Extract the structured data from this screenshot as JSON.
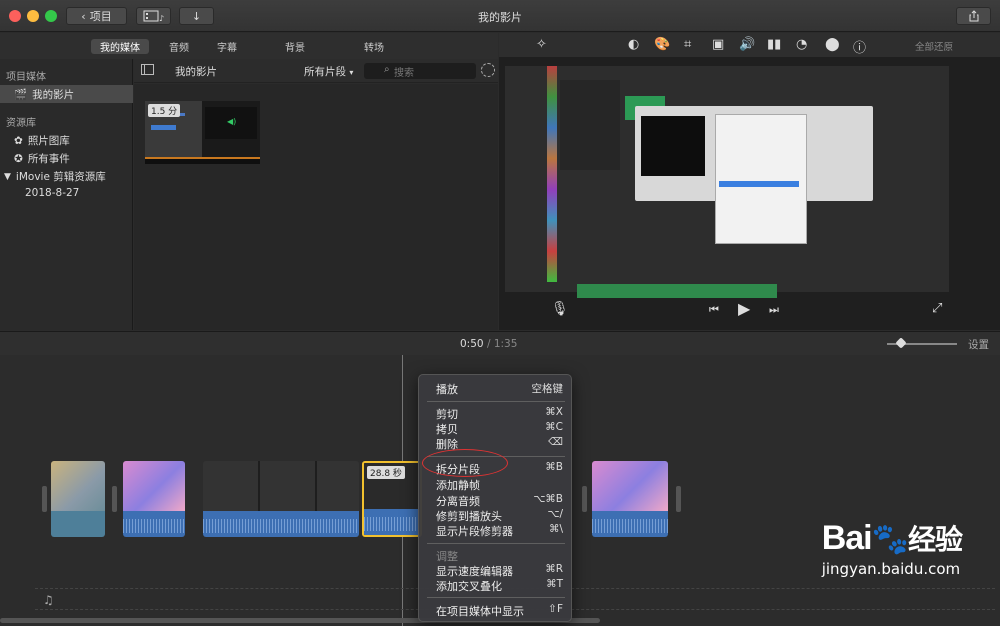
{
  "window": {
    "title": "我的影片",
    "back_label": "项目"
  },
  "browser": {
    "tabs": [
      "我的媒体",
      "音频",
      "字幕",
      "背景",
      "转场"
    ],
    "active_tab": 0,
    "sidebar": {
      "section1": "项目媒体",
      "item_my_movie": "我的影片",
      "section2": "资源库",
      "photo_library": "照片图库",
      "all_events": "所有事件",
      "imovie_library": "iMovie 剪辑资源库",
      "event_date": "2018-8-27"
    },
    "toolbar": {
      "title": "我的影片",
      "filter": "所有片段",
      "search_placeholder": "搜索"
    },
    "thumb_duration": "1.5 分"
  },
  "viewer": {
    "reset_label": "全部还原"
  },
  "timeline": {
    "time_current": "0:50",
    "time_sep": "/",
    "time_total": "1:35",
    "settings_label": "设置",
    "selected_clip_duration": "28.8 秒"
  },
  "context_menu": {
    "items": [
      {
        "label": "播放",
        "shortcut": "空格键",
        "disabled": false
      },
      {
        "label": "剪切",
        "shortcut": "⌘X",
        "disabled": false
      },
      {
        "label": "拷贝",
        "shortcut": "⌘C",
        "disabled": false
      },
      {
        "label": "删除",
        "shortcut": "⌫",
        "disabled": false
      },
      {
        "label": "拆分片段",
        "shortcut": "⌘B",
        "disabled": false
      },
      {
        "label": "添加静帧",
        "shortcut": "",
        "disabled": false
      },
      {
        "label": "分离音频",
        "shortcut": "⌥⌘B",
        "disabled": false
      },
      {
        "label": "修剪到播放头",
        "shortcut": "⌥/",
        "disabled": false
      },
      {
        "label": "显示片段修剪器",
        "shortcut": "⌘\\",
        "disabled": false
      },
      {
        "label": "调整",
        "shortcut": "",
        "disabled": true
      },
      {
        "label": "显示速度编辑器",
        "shortcut": "⌘R",
        "disabled": false
      },
      {
        "label": "添加交叉叠化",
        "shortcut": "⌘T",
        "disabled": false
      },
      {
        "label": "在项目媒体中显示",
        "shortcut": "⇧F",
        "disabled": false
      }
    ]
  },
  "watermark": {
    "brand": "Bai",
    "brand2": "经验",
    "url": "jingyan.baidu.com"
  },
  "colors": {
    "accent_selection": "#f2c12e",
    "audio_blue": "#3d6fb3",
    "highlight_circle": "#d33"
  }
}
